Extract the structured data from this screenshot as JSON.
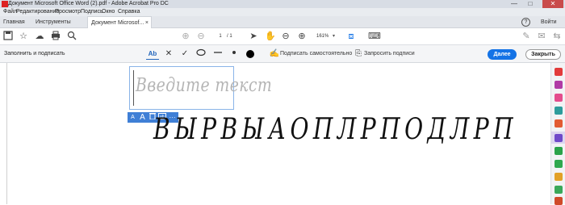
{
  "window": {
    "title": "Документ Microsoft Office Word (2).pdf - Adobe Acrobat Pro DC",
    "minimize": "—",
    "maximize": "□",
    "close": "✕"
  },
  "menu": {
    "items": [
      "Файл",
      "Редактирование",
      "Просмотр",
      "Подпись",
      "Окно",
      "Справка"
    ]
  },
  "tabs": {
    "home": "Главная",
    "tools": "Инструменты",
    "document": "Документ Microsof...",
    "document_close": "×",
    "help": "?",
    "signin": "Войти"
  },
  "toolbar": {
    "page_current": "1",
    "page_total": "/ 1",
    "zoom": "161%",
    "zoom_dropdown": "▾"
  },
  "fillsign": {
    "label": "Заполнить и подписать",
    "text_tool": "Ab",
    "cross": "✕",
    "check": "✓",
    "sign_yourself": "Подписать самостоятельно",
    "request_signatures": "Запросить подписи",
    "next_button": "Далее",
    "close_button": "Закрыть"
  },
  "document": {
    "textbox_placeholder": "Введите текст",
    "minibar": {
      "smaller": "A",
      "larger": "A",
      "delete": "🗑",
      "more": "···"
    },
    "handwritten_text": "ВЫРВЫАОПЛРПОДЛРП"
  },
  "colors": {
    "accent": "#1473e6",
    "active_tool": "#dcd6ef",
    "textbox_border": "#8ab4e8"
  }
}
